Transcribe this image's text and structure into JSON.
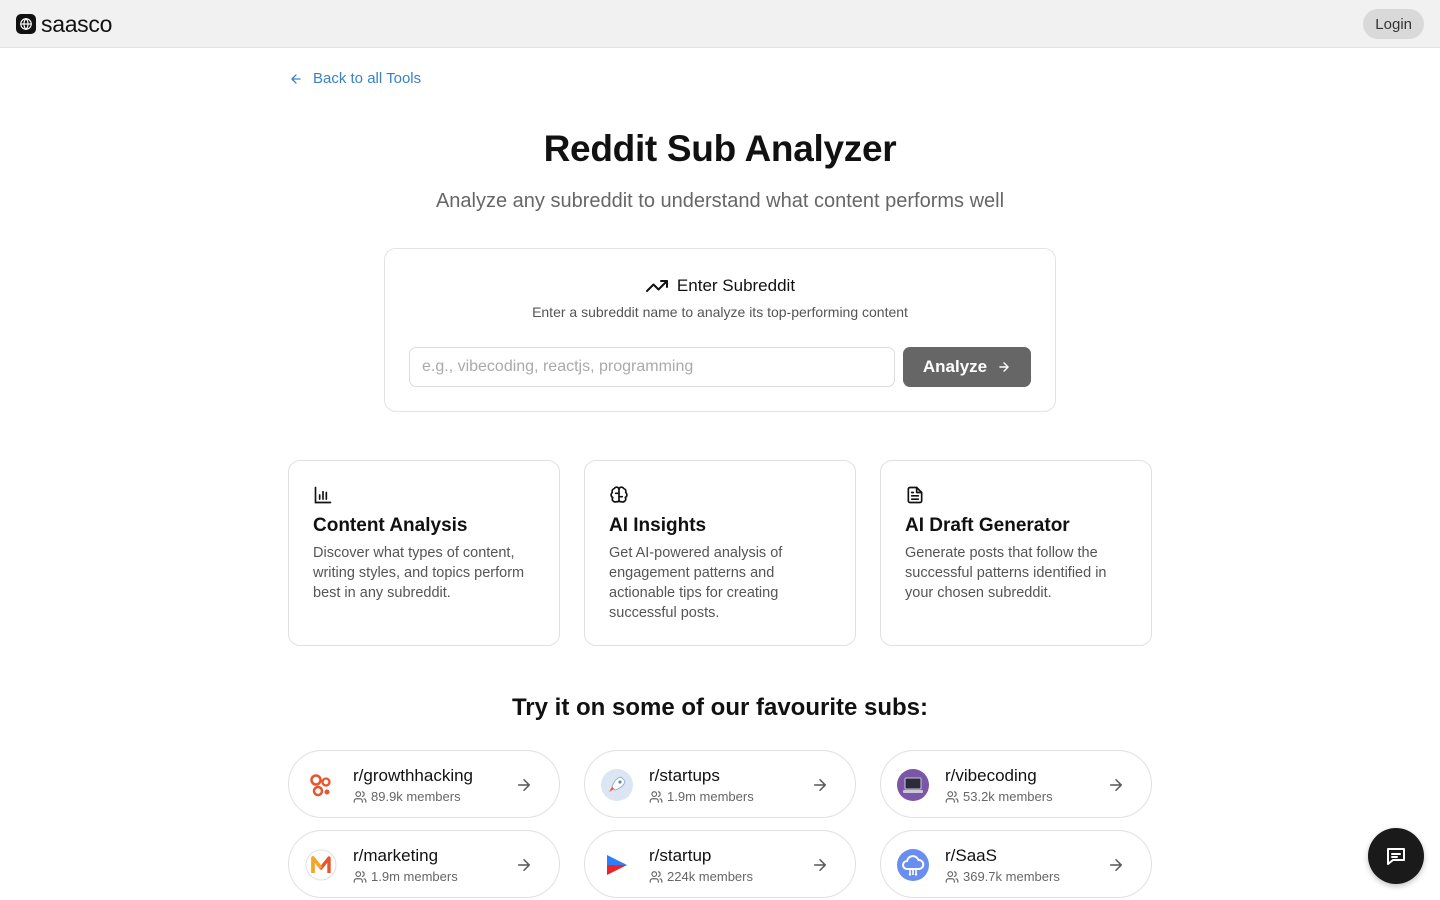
{
  "header": {
    "logo_text": "saasco",
    "login_label": "Login"
  },
  "nav": {
    "back_label": "Back to all Tools"
  },
  "hero": {
    "title": "Reddit Sub Analyzer",
    "subtitle": "Analyze any subreddit to understand what content performs well"
  },
  "input_card": {
    "title": "Enter Subreddit",
    "description": "Enter a subreddit name to analyze its top-performing content",
    "placeholder": "e.g., vibecoding, reactjs, programming",
    "value": "",
    "button_label": "Analyze"
  },
  "features": [
    {
      "icon": "bar-chart-icon",
      "title": "Content Analysis",
      "description": "Discover what types of content, writing styles, and topics perform best in any subreddit."
    },
    {
      "icon": "brain-icon",
      "title": "AI Insights",
      "description": "Get AI-powered analysis of engagement patterns and actionable tips for creating successful posts."
    },
    {
      "icon": "document-icon",
      "title": "AI Draft Generator",
      "description": "Generate posts that follow the successful patterns identified in your chosen subreddit."
    }
  ],
  "favourites": {
    "heading": "Try it on some of our favourite subs:",
    "subs": [
      {
        "name": "r/growthhacking",
        "members": "89.9k members",
        "icon": "gears-icon"
      },
      {
        "name": "r/startups",
        "members": "1.9m members",
        "icon": "rocket-icon"
      },
      {
        "name": "r/vibecoding",
        "members": "53.2k members",
        "icon": "laptop-icon"
      },
      {
        "name": "r/marketing",
        "members": "1.9m members",
        "icon": "m-logo-icon"
      },
      {
        "name": "r/startup",
        "members": "224k members",
        "icon": "play-arrow-icon"
      },
      {
        "name": "r/SaaS",
        "members": "369.7k members",
        "icon": "cloud-icon"
      }
    ]
  },
  "colors": {
    "link_blue": "#3b82c4",
    "analyze_button": "#666666",
    "chat_button": "#1a1a1a",
    "topbar_bg": "#f1f1f1"
  }
}
